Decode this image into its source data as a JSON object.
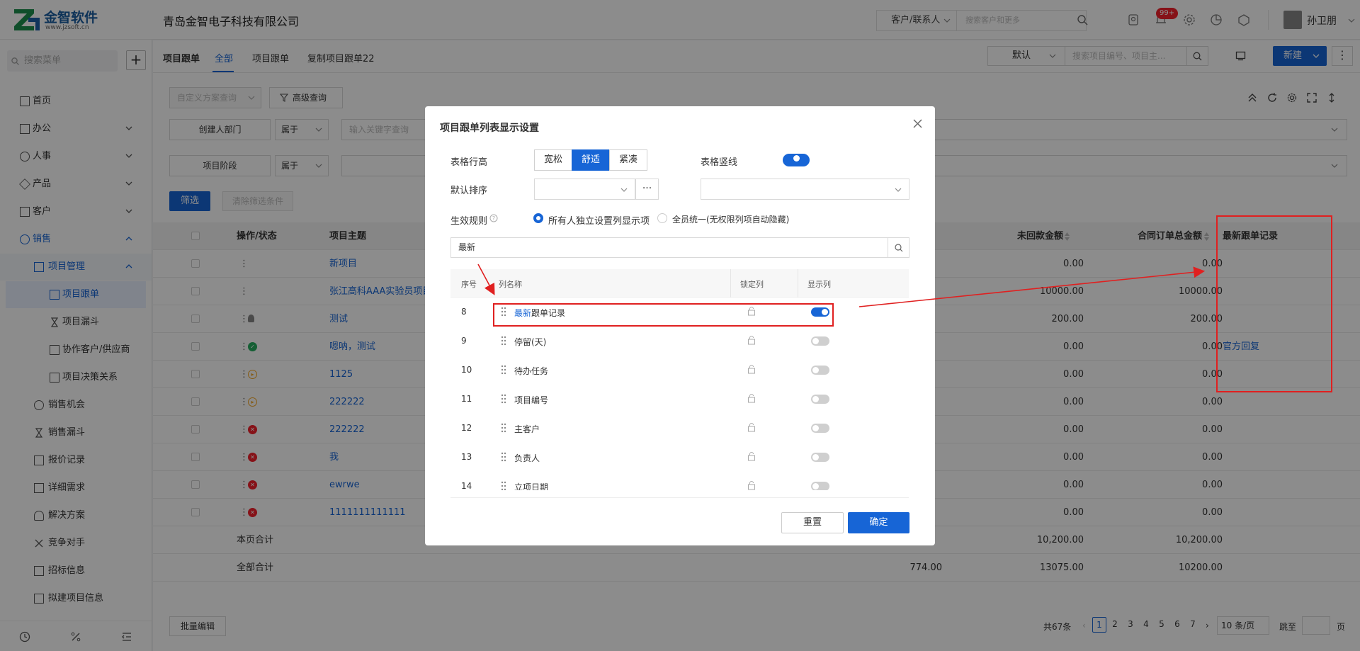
{
  "topbar": {
    "logo_text": "金智软件",
    "logo_sub": "www.jzsoft.cn",
    "company": "青岛金智电子科技有限公司",
    "cust_select": "客户/联系人",
    "search_placeholder": "搜索客户和更多",
    "badge": "99+",
    "username": "孙卫朋"
  },
  "sidebar": {
    "search_placeholder": "搜索菜单",
    "add": "+",
    "items": [
      {
        "label": "首页",
        "icon": "home-icon"
      },
      {
        "label": "办公",
        "icon": "office-icon"
      },
      {
        "label": "人事",
        "icon": "hr-icon"
      },
      {
        "label": "产品",
        "icon": "product-icon"
      },
      {
        "label": "客户",
        "icon": "customer-icon"
      },
      {
        "label": "销售",
        "icon": "sales-icon"
      },
      {
        "label": "项目管理",
        "icon": "project-icon"
      },
      {
        "label": "项目跟单",
        "icon": "doc-icon"
      },
      {
        "label": "项目漏斗",
        "icon": "hourglass-icon"
      },
      {
        "label": "协作客户/供应商",
        "icon": "doc-icon"
      },
      {
        "label": "项目决策关系",
        "icon": "doc-icon"
      },
      {
        "label": "销售机会",
        "icon": "target-icon"
      },
      {
        "label": "销售漏斗",
        "icon": "hourglass-icon"
      },
      {
        "label": "报价记录",
        "icon": "doc-icon"
      },
      {
        "label": "详细需求",
        "icon": "doc-icon"
      },
      {
        "label": "解决方案",
        "icon": "bulb-icon"
      },
      {
        "label": "竞争对手",
        "icon": "fight-icon"
      },
      {
        "label": "招标信息",
        "icon": "doc-icon"
      },
      {
        "label": "拟建项目信息",
        "icon": "doc-icon"
      }
    ]
  },
  "tabs": {
    "title": "项目跟单",
    "items": [
      "全部",
      "项目跟单",
      "复制项目跟单22"
    ],
    "default_view": "默认",
    "search_placeholder": "搜索项目编号、项目主...",
    "new_label": "新建",
    "more": "⋮"
  },
  "filters": {
    "custom_query": "自定义方案查询",
    "advanced": "高级查询",
    "field1": "创建人部门",
    "op1": "属于",
    "kw_placeholder": "输入关键字查询",
    "field2": "项目阶段",
    "op2": "属于",
    "filter_btn": "筛选",
    "clear_btn": "清除筛选条件"
  },
  "table": {
    "headers": {
      "action": "操作/状态",
      "subject": "项目主题",
      "unpaid": "未回款金额",
      "contract_total": "合同订单总金额",
      "latest": "最新跟单记录"
    },
    "rows": [
      {
        "subject": "新项目",
        "unpaid": "0.00",
        "total": "0.00",
        "latest": "",
        "status": "none"
      },
      {
        "subject": "张江高科AAA实验员项目",
        "unpaid": "10000.00",
        "total": "10000.00",
        "latest": "",
        "status": "none"
      },
      {
        "subject": "测试",
        "unpaid": "200.00",
        "total": "200.00",
        "latest": "",
        "status": "person"
      },
      {
        "subject": "嗯呐，测试",
        "unpaid": "0.00",
        "total": "0.00",
        "latest": "官方回复",
        "status": "ok"
      },
      {
        "subject": "1125",
        "unpaid": "0.00",
        "total": "0.00",
        "latest": "",
        "status": "play"
      },
      {
        "subject": "222222",
        "unpaid": "0.00",
        "total": "0.00",
        "latest": "",
        "status": "play"
      },
      {
        "subject": "222222",
        "unpaid": "0.00",
        "total": "0.00",
        "latest": "",
        "status": "err"
      },
      {
        "subject": "我",
        "unpaid": "0.00",
        "total": "0.00",
        "latest": "",
        "status": "err"
      },
      {
        "subject": "ewrwe",
        "unpaid": "0.00",
        "total": "0.00",
        "latest": "",
        "status": "err"
      },
      {
        "subject": "1111111111111",
        "unpaid": "0.00",
        "total": "0.00",
        "latest": "",
        "status": "err"
      }
    ],
    "page_total": {
      "label": "本页合计",
      "unpaid": "10,200.00",
      "total": "10,200.00"
    },
    "all_total": {
      "label": "全部合计",
      "other": "774.00",
      "unpaid": "13075.00",
      "total": "10200.00"
    }
  },
  "footer": {
    "batch_edit": "批量编辑",
    "total": "共67条",
    "pages": [
      "1",
      "2",
      "3",
      "4",
      "5",
      "6",
      "7"
    ],
    "page_size": "10 条/页",
    "goto": "跳至",
    "page_unit": "页"
  },
  "modal": {
    "title": "项目跟单列表显示设置",
    "row_height_label": "表格行高",
    "row_height_options": [
      "宽松",
      "舒适",
      "紧凑"
    ],
    "vline_label": "表格竖线",
    "sort_label": "默认排序",
    "sort_more": "···",
    "rule_label": "生效规则",
    "rule_option1": "所有人独立设置列显示项",
    "rule_option2": "全员统一(无权限列项自动隐藏)",
    "search_value": "最新",
    "col_headers": {
      "idx": "序号",
      "name": "列名称",
      "lock": "锁定列",
      "show": "显示列"
    },
    "columns": [
      {
        "idx": "8",
        "highlight": "最新",
        "rest": "跟单记录",
        "show": true
      },
      {
        "idx": "9",
        "highlight": "",
        "rest": "停留(天)",
        "show": false
      },
      {
        "idx": "10",
        "highlight": "",
        "rest": "待办任务",
        "show": false
      },
      {
        "idx": "11",
        "highlight": "",
        "rest": "项目编号",
        "show": false
      },
      {
        "idx": "12",
        "highlight": "",
        "rest": "主客户",
        "show": false
      },
      {
        "idx": "13",
        "highlight": "",
        "rest": "负责人",
        "show": false
      },
      {
        "idx": "14",
        "highlight": "",
        "rest": "立项日期",
        "show": false
      }
    ],
    "reset": "重置",
    "confirm": "确定"
  },
  "colors": {
    "primary": "#1765d6",
    "annotation": "#e02020",
    "danger": "#f5222d",
    "success": "#27ae60",
    "warning": "#f5a623"
  }
}
